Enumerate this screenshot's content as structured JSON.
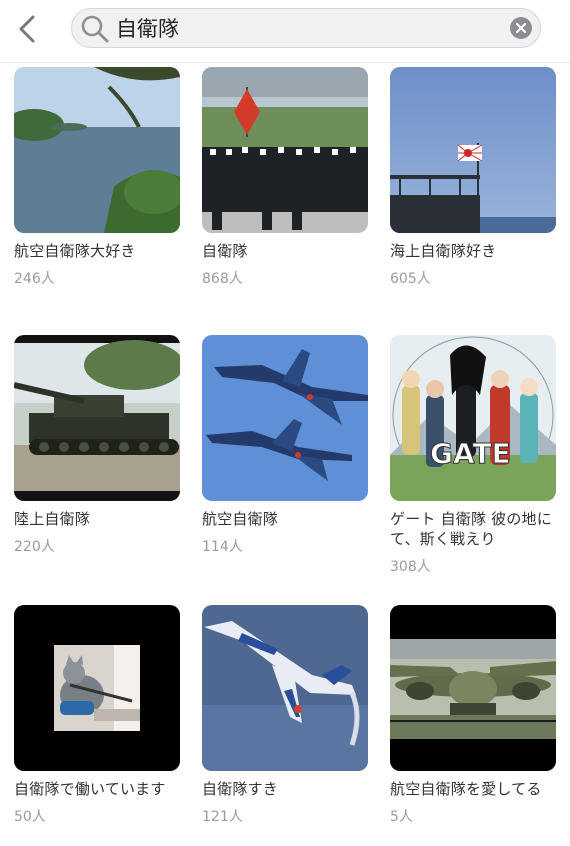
{
  "search": {
    "query": "自衛隊"
  },
  "groups": [
    {
      "title": "航空自衛隊大好き",
      "members": "246人"
    },
    {
      "title": "自衛隊",
      "members": "868人"
    },
    {
      "title": "海上自衛隊好き",
      "members": "605人"
    },
    {
      "title": "陸上自衛隊",
      "members": "220人"
    },
    {
      "title": "航空自衛隊",
      "members": "114人"
    },
    {
      "title": "ゲート 自衛隊 彼の地にて、斯く戦えり",
      "members": "308人",
      "thumb_text": "GATE"
    },
    {
      "title": "自衛隊で働いています",
      "members": "50人"
    },
    {
      "title": "自衛隊すき",
      "members": "121人"
    },
    {
      "title": "航空自衛隊を愛してる",
      "members": "5人"
    }
  ]
}
